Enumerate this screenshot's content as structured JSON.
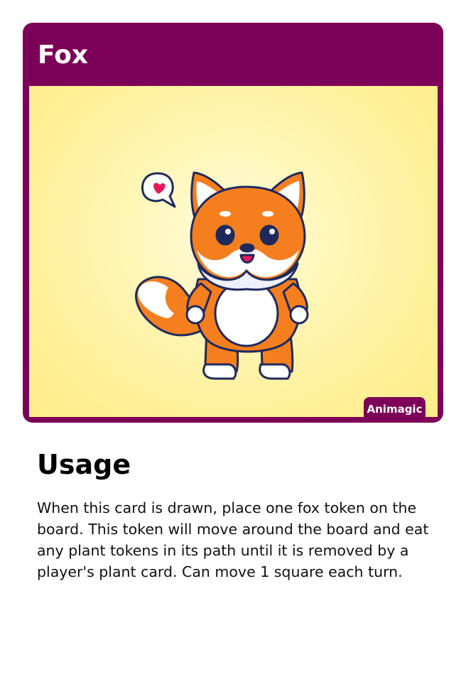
{
  "card": {
    "title": "Fox",
    "badge": "Animagic",
    "image": "cute-fox-illustration",
    "colors": {
      "frame": "#7d0058",
      "art_background": "#fff09a",
      "fox_orange": "#f57f1f"
    }
  },
  "usage": {
    "heading": "Usage",
    "text": "When this card is drawn, place one fox token on the board. This token will move around the board and eat any plant tokens in its path until it is removed by a player's plant card. Can move 1 square each turn."
  }
}
